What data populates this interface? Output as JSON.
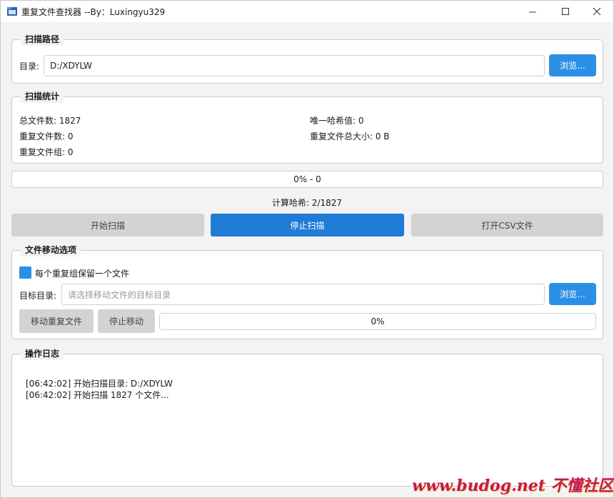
{
  "window": {
    "title": "重复文件查找器 --By：Luxingyu329",
    "controls": {
      "minimize": "—",
      "maximize": "☐",
      "close": "✕"
    }
  },
  "scan_path": {
    "group_title": "扫描路径",
    "dir_label": "目录:",
    "dir_value": "D:/XDYLW",
    "browse_label": "浏览..."
  },
  "scan_stats": {
    "group_title": "扫描统计",
    "total_files": "总文件数: 1827",
    "unique_hashes": "唯一哈希值: 0",
    "duplicate_files": "重复文件数: 0",
    "duplicate_total_size": "重复文件总大小: 0 B",
    "duplicate_groups": "重复文件组: 0"
  },
  "scan_progress": {
    "percent": 0,
    "text": "0% - 0"
  },
  "status_text": "计算哈希: 2/1827",
  "actions": {
    "start_scan": "开始扫描",
    "stop_scan": "停止扫描",
    "open_csv": "打开CSV文件"
  },
  "move_options": {
    "group_title": "文件移动选项",
    "keep_one_checked": true,
    "keep_one_label": "每个重复组保留一个文件",
    "target_label": "目标目录:",
    "target_placeholder": "请选择移动文件的目标目录",
    "browse_label": "浏览...",
    "move_button": "移动重复文件",
    "stop_move_button": "停止移动",
    "move_progress_percent": 0,
    "move_progress_text": "0%"
  },
  "log": {
    "group_title": "操作日志",
    "lines": [
      "[06:42:02] 开始扫描目录: D:/XDYLW",
      "[06:42:02] 开始扫描 1827 个文件..."
    ]
  },
  "watermark": "www.budog.net 不懂社区",
  "colors": {
    "accent_blue": "#2b8fe6",
    "primary_button": "#1f7bd6",
    "disabled_button": "#d3d3d3",
    "watermark": "#c2185b"
  }
}
